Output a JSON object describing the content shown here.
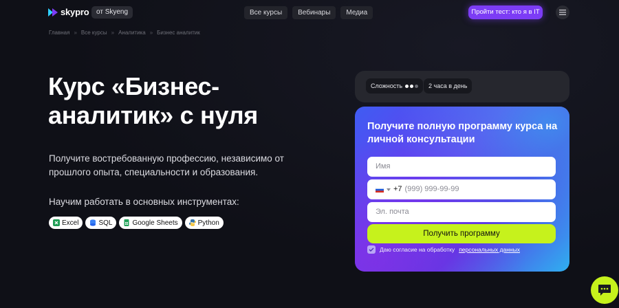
{
  "header": {
    "logo_text": "skypro",
    "from_badge": "от Skyeng",
    "nav": [
      {
        "label": "Все курсы"
      },
      {
        "label": "Вебинары"
      },
      {
        "label": "Медиа"
      }
    ],
    "cta_label": "Пройти тест: кто я в IT"
  },
  "breadcrumb": [
    "Главная",
    "Все курсы",
    "Аналитика",
    "Бизнес аналитик"
  ],
  "breadcrumb_separator": "»",
  "hero": {
    "title": "Курс «Бизнес-аналитик» с нуля",
    "subtitle": "Получите востребованную профессию, независимо от прошлого опыта, специальности и образования.",
    "tools_title": "Научим работать в основных инструментах:",
    "tools": [
      {
        "label": "Excel",
        "icon": "excel-icon",
        "color": "#1f9d55"
      },
      {
        "label": "SQL",
        "icon": "database-icon",
        "color": "#3b82f6"
      },
      {
        "label": "Google Sheets",
        "icon": "google-sheets-icon",
        "color": "#22a35a"
      },
      {
        "label": "Python",
        "icon": "python-icon",
        "color": "#3776ab"
      }
    ]
  },
  "info": {
    "difficulty_label": "Сложность",
    "difficulty_level": 2,
    "difficulty_max": 3,
    "time_label": "2 часа в день"
  },
  "form": {
    "title": "Получите полную программу курса на личной консультации",
    "name_placeholder": "Имя",
    "phone_code": "+7",
    "phone_mask": "(999) 999-99-99",
    "email_placeholder": "Эл. почта",
    "submit_label": "Получить программу",
    "consent_text": "Даю согласие на обработку",
    "consent_link": "персональных данных",
    "consent_checked": true
  },
  "colors": {
    "accent": "#7c3cf5",
    "lime": "#c6f21c",
    "background": "#0f1017"
  }
}
